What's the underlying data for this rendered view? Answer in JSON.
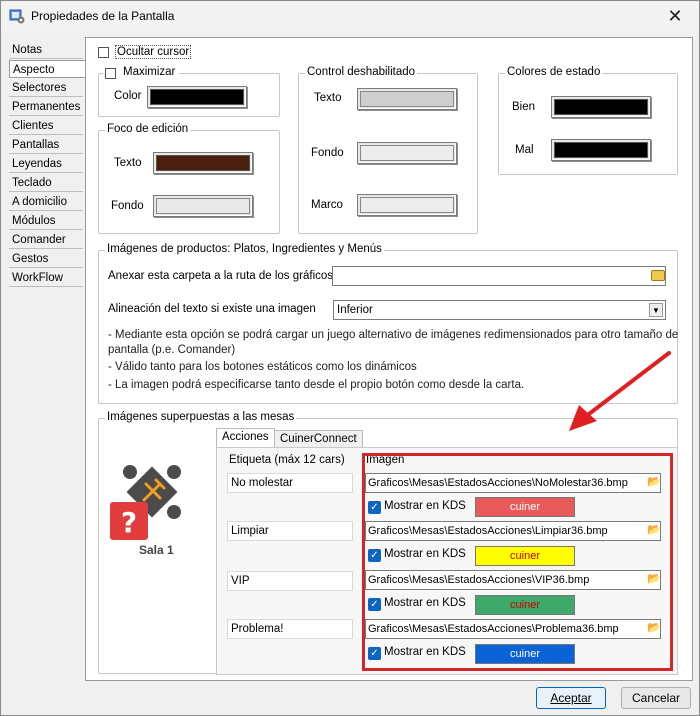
{
  "window": {
    "title": "Propiedades de la Pantalla"
  },
  "sidebar": {
    "items": [
      {
        "label": "Notas"
      },
      {
        "label": "Aspecto"
      },
      {
        "label": "Selectores"
      },
      {
        "label": "Permanentes"
      },
      {
        "label": "Clientes"
      },
      {
        "label": "Pantallas"
      },
      {
        "label": "Leyendas"
      },
      {
        "label": "Teclado"
      },
      {
        "label": "A domicilio"
      },
      {
        "label": "Módulos"
      },
      {
        "label": "Comander"
      },
      {
        "label": "Gestos"
      },
      {
        "label": "WorkFlow"
      }
    ],
    "active_index": 1
  },
  "aspecto": {
    "ocultar_cursor": "Ocultar cursor",
    "maximizar": {
      "legend": "Maximizar",
      "color_label": "Color",
      "color": "#000000"
    },
    "foco": {
      "legend": "Foco de edición",
      "texto_label": "Texto",
      "texto_color": "#4a1f0d",
      "fondo_label": "Fondo",
      "fondo_color": "#e9e9e9"
    },
    "control_deshabilitado": {
      "legend": "Control deshabilitado",
      "texto_label": "Texto",
      "texto_color": "#cfcfcf",
      "fondo_label": "Fondo",
      "fondo_color": "#ececec",
      "marco_label": "Marco",
      "marco_color": "#ececec"
    },
    "colores_estado": {
      "legend": "Colores de estado",
      "bien_label": "Bien",
      "bien_color": "#000000",
      "mal_label": "Mal",
      "mal_color": "#000000"
    },
    "imagenes_productos": {
      "legend": "Imágenes de productos: Platos, Ingredientes y Menús",
      "anexar_label": "Anexar esta carpeta a la ruta de los gráficos",
      "anexar_value": "",
      "alineacion_label": "Alineación del texto si  existe una imagen",
      "alineacion_value": "Inferior",
      "note1": "- Mediante esta opción se podrá cargar un juego alternativo de imágenes redimensionados para otro tamaño de",
      "note1b": "pantalla (p.e. Comander)",
      "note2": "- Válido tanto para los botones estáticos como los dinámicos",
      "note3": "- La imagen podrá especificarse tanto desde el propio botón como desde la carta."
    },
    "imagenes_mesas": {
      "legend": "Imágenes superpuestas a las mesas",
      "tabs": [
        {
          "label": "Acciones"
        },
        {
          "label": "CuinerConnect"
        }
      ],
      "preview_label": "Sala 1",
      "col_etiqueta": "Etiqueta (máx 12 cars)",
      "col_imagen": "Imagen",
      "rows": [
        {
          "etiqueta": "No molestar",
          "imagen": "Graficos\\Mesas\\EstadosAcciones\\NoMolestar36.bmp",
          "kds_label": "Mostrar en KDS",
          "color_label": "cuiner",
          "color": "#e85a5a"
        },
        {
          "etiqueta": "Limpiar",
          "imagen": "Graficos\\Mesas\\EstadosAcciones\\Limpiar36.bmp",
          "kds_label": "Mostrar en KDS",
          "color_label": "cuiner",
          "color": "#ffff00"
        },
        {
          "etiqueta": "VIP",
          "imagen": "Graficos\\Mesas\\EstadosAcciones\\VIP36.bmp",
          "kds_label": "Mostrar en KDS",
          "color_label": "cuiner",
          "color": "#3fa86a"
        },
        {
          "etiqueta": "Problema!",
          "imagen": "Graficos\\Mesas\\EstadosAcciones\\Problema36.bmp",
          "kds_label": "Mostrar en KDS",
          "color_label": "cuiner",
          "color": "#0a63d6"
        }
      ]
    }
  },
  "footer": {
    "accept_label": "Aceptar",
    "cancel_label": "Cancelar"
  },
  "icons": {
    "app": "app-icon",
    "close": "close-icon",
    "folder": "folder-icon",
    "browse": "browse-icon",
    "arrow": "red-arrow-annotation"
  }
}
